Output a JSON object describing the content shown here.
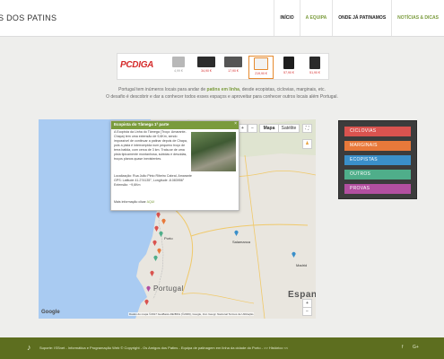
{
  "header": {
    "brand": "S DOS PATINS",
    "nav": [
      "INÍCIO",
      "A EQUIPA",
      "ONDE JÁ PATINAMOS",
      "NOTÍCIAS & DICAS"
    ]
  },
  "banner": {
    "logo": "PCDIGA",
    "prices": [
      "4,99 €",
      "34,90 €",
      "17,90 €",
      "219,90 €",
      "57,90 €",
      "51,90 €"
    ]
  },
  "intro": {
    "line1_pre": "Portugal tem inúmeros locais para andar de ",
    "line1_bold": "patins em linha",
    "line1_post": ", desde ecopistas, ciclovias, marginais, etc.",
    "line2": "O desafio é descobrir e dar a conhecer todos esses espaços e aproveitar para conhecer outros locais além Portugal."
  },
  "map": {
    "btn_plus": "+",
    "btn_minus": "−",
    "btn_map": "Mapa",
    "btn_satellite": "Satélite",
    "google_label": "Google",
    "footer_text": "Dados do mapa ©2017 GeoBasis-DE/BKG (©2009), Google, Inst. Geogr. Nacional   Termos de Utilização",
    "label_portugal": "Portugal",
    "label_espana": "Espan",
    "city_porto": "Porto",
    "city_salamanca": "Salamanca",
    "city_madrid": "Madrid"
  },
  "popup": {
    "title": "Ecopista do Tâmega 1ª parte",
    "close": "×",
    "text1": "A Ecopista da Linha do Tâmega (Troço: Amarante-Chapa) tem uma extensão de 9,6Km, sendo impossível de continuar a patinar depois de Chapa, pois a pista é interrompida num pequeno troço de terra batida, com cerca de 3 km. Trata-se de uma pista tipicamente montanhosa, subidas e descidas, troços planos quase inexistentes.",
    "location": "Localização: Rua João Pinto Ribeiro Cabral, Amarante",
    "gps": "GPS: Latitude 41.274135°, Longitude -8.083956°",
    "extension": "Extensão: ~9,6Km",
    "more_label": "Mais informação clicar ",
    "more_link": "AQUI"
  },
  "legend": {
    "items": [
      "CICLOVIAS",
      "MARGINAIS",
      "ECOPISTAS",
      "OUTROS",
      "PROVAS"
    ],
    "colors": [
      "#d9534f",
      "#e8793a",
      "#3a8fc9",
      "#4fae8a",
      "#b24fa0"
    ]
  },
  "footer": {
    "logo": "♪",
    "text": "Suporte: ISSnet - Informática e Programação Web   © Copyright - Os Amigos dos Patins - Equipa de patinagem em linha da cidade do Porto - >> Histórico <<",
    "social": [
      "f",
      "G+"
    ]
  }
}
